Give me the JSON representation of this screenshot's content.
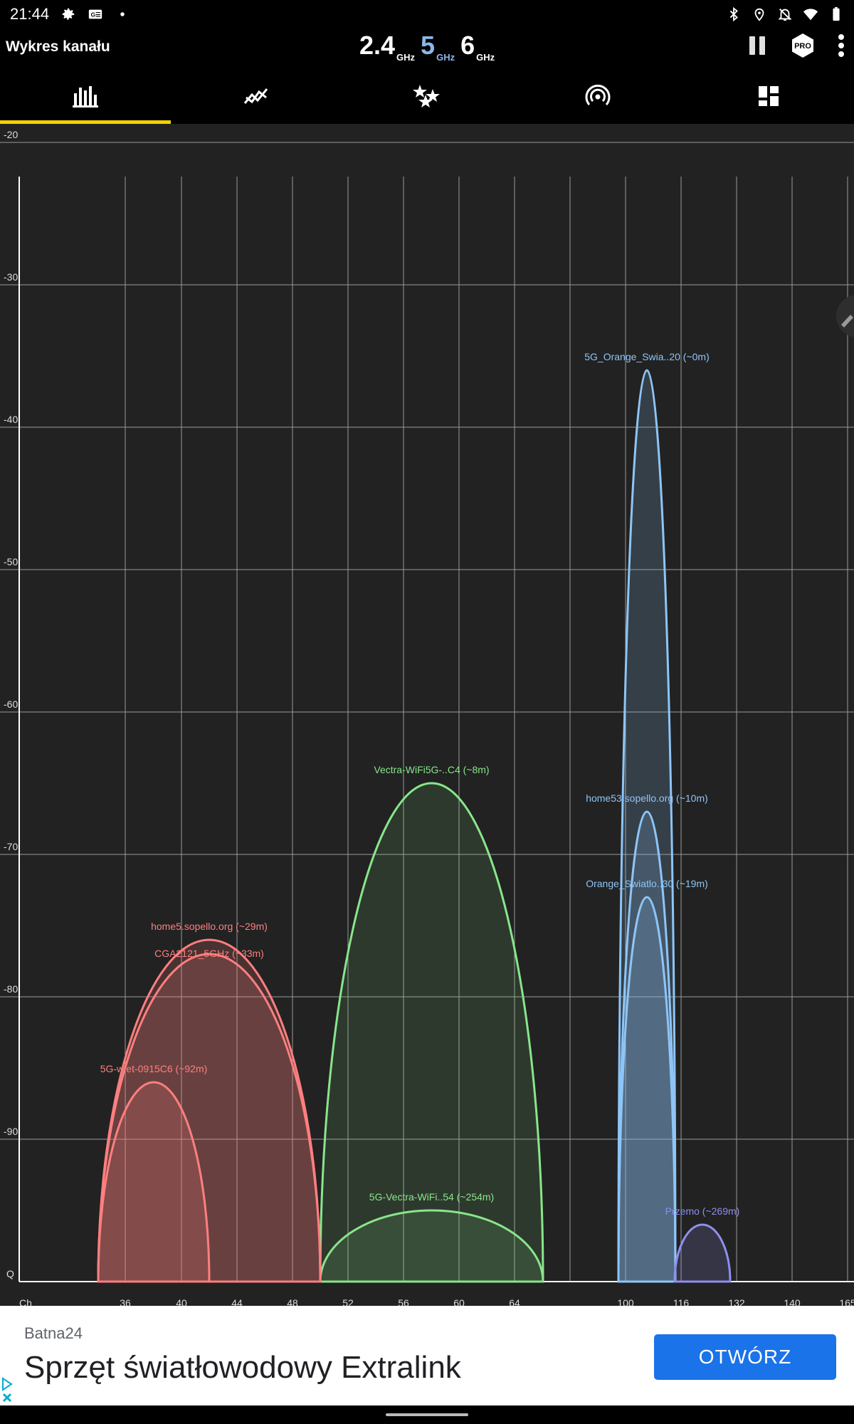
{
  "status_bar": {
    "time": "21:44",
    "icons_left": [
      "gear-icon",
      "data-saver-icon",
      "dot-icon"
    ],
    "icons_right": [
      "bluetooth-icon",
      "location-icon",
      "notifications-off-icon",
      "wifi-icon",
      "battery-icon"
    ]
  },
  "toolbar": {
    "title": "Wykres kanału",
    "bands": [
      {
        "num": "2.4",
        "unit": "GHz",
        "active": false
      },
      {
        "num": "5",
        "unit": "GHz",
        "active": true
      },
      {
        "num": "6",
        "unit": "GHz",
        "active": false
      }
    ],
    "pro_label": "PRO",
    "actions": [
      "pause-icon",
      "pro-badge-icon",
      "more-vert-icon"
    ]
  },
  "tabs": [
    {
      "name": "tab-channel-graph",
      "icon": "bar-chart-icon",
      "active": true
    },
    {
      "name": "tab-time-graph",
      "icon": "trending-icon",
      "active": false
    },
    {
      "name": "tab-channel-rating",
      "icon": "stars-icon",
      "active": false
    },
    {
      "name": "tab-access-points",
      "icon": "wifi-tethering-icon",
      "active": false
    },
    {
      "name": "tab-dashboard",
      "icon": "dashboard-icon",
      "active": false
    }
  ],
  "chart_data": {
    "type": "area",
    "y_ticks": [
      "-20",
      "-30",
      "-40",
      "-50",
      "-60",
      "-70",
      "-80",
      "-90",
      "Q"
    ],
    "ylim": [
      -100,
      -20
    ],
    "x_tick_labels": [
      "Ch",
      "36",
      "40",
      "44",
      "48",
      "52",
      "56",
      "60",
      "64",
      "100",
      "116",
      "132",
      "140",
      "165"
    ],
    "grid": true,
    "networks": [
      {
        "label": "5G_Orange_Swia..20 (~0m)",
        "signal": -36,
        "color": "#8ec5f7"
      },
      {
        "label": "home53.sopello.org (~10m)",
        "signal": -67,
        "color": "#8ec5f7"
      },
      {
        "label": "Orange_Swiatlo..30 (~19m)",
        "signal": -73,
        "color": "#8ec5f7"
      },
      {
        "label": "Vectra-WiFi5G-..C4 (~8m)",
        "signal": -65,
        "color": "#88e68a"
      },
      {
        "label": "5G-Vectra-WiFi..54 (~254m)",
        "signal": -95,
        "color": "#88e68a"
      },
      {
        "label": "home5.sopello.org (~29m)",
        "signal": -76,
        "color": "#ff7f7f"
      },
      {
        "label": "CGA2121_5GHz (~33m)",
        "signal": -77,
        "color": "#ff7f7f"
      },
      {
        "label": "5G-wlet-0915C6 (~92m)",
        "signal": -86,
        "color": "#ff7f7f"
      },
      {
        "label": "Przemo (~269m)",
        "signal": -96,
        "color": "#8f8ff0"
      }
    ]
  },
  "ad": {
    "brand": "Batna24",
    "headline": "Sprzęt światłowodowy Extralink",
    "button": "OTWÓRZ",
    "button_color": "#1a73e8"
  }
}
